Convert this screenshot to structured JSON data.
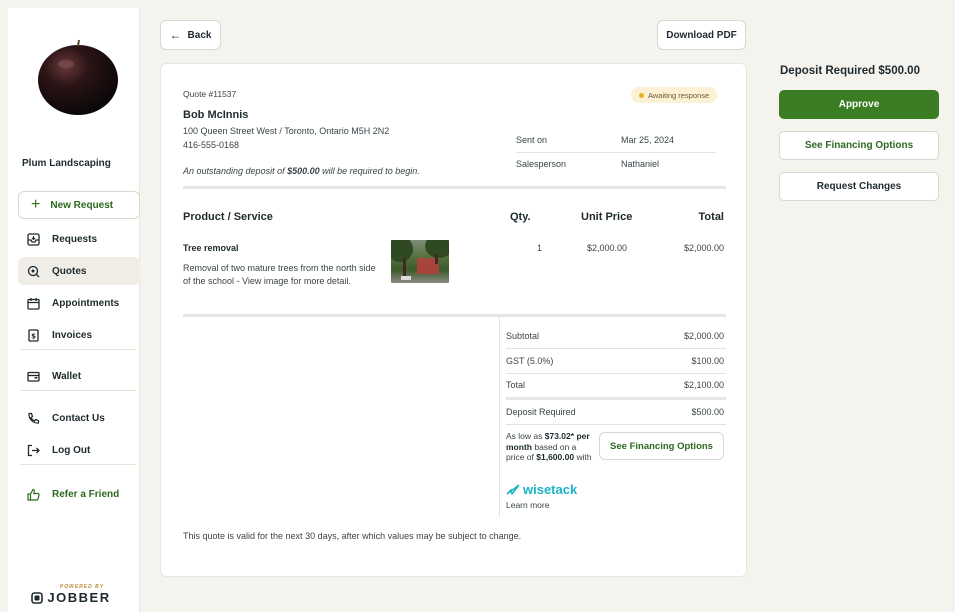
{
  "sidebar": {
    "company": "Plum Landscaping",
    "new_request": "New Request",
    "items": [
      {
        "label": "Requests"
      },
      {
        "label": "Quotes"
      },
      {
        "label": "Appointments"
      },
      {
        "label": "Invoices"
      },
      {
        "label": "Wallet"
      },
      {
        "label": "Contact Us"
      },
      {
        "label": "Log Out"
      },
      {
        "label": "Refer a Friend"
      }
    ],
    "powered_by": "POWERED BY",
    "brand": "JOBBER"
  },
  "toolbar": {
    "back": "Back",
    "download": "Download PDF"
  },
  "quote": {
    "number": "Quote #11537",
    "status": "Awaiting response",
    "client_name": "Bob McInnis",
    "address": "100 Queen Street West / Toronto, Ontario M5H 2N2",
    "phone": "416-555-0168",
    "deposit_note_prefix": "An outstanding deposit of",
    "deposit_note_amount": "$500.00",
    "deposit_note_suffix": "will be required to begin.",
    "sent_on_label": "Sent on",
    "sent_on_value": "Mar 25, 2024",
    "salesperson_label": "Salesperson",
    "salesperson_value": "Nathaniel",
    "headers": {
      "product": "Product / Service",
      "qty": "Qty.",
      "unit_price": "Unit Price",
      "total": "Total"
    },
    "line_item": {
      "name": "Tree removal",
      "description": "Removal of two mature trees from the north side of the school - View image for more detail.",
      "qty": "1",
      "unit_price": "$2,000.00",
      "total": "$2,000.00"
    },
    "summary": {
      "subtotal_label": "Subtotal",
      "subtotal": "$2,000.00",
      "gst_label": "GST (5.0%)",
      "gst": "$100.00",
      "total_label": "Total",
      "total": "$2,100.00",
      "deposit_label": "Deposit Required",
      "deposit": "$500.00"
    },
    "financing": {
      "as_low_as": "As low as",
      "amount": "$73.02*",
      "per_month": "per month",
      "based_on": "based on a price of",
      "price": "$1,600.00",
      "with": "with",
      "provider": "wisetack",
      "learn_more": "Learn more",
      "button": "See Financing Options"
    },
    "validity": "This quote is valid for the next 30 days, after which values may be subject to change."
  },
  "panel": {
    "deposit_title": "Deposit Required $500.00",
    "approve": "Approve",
    "financing": "See Financing Options",
    "changes": "Request Changes"
  },
  "colors": {
    "primary_green": "#3a7d23",
    "status_bg": "#fbf1d5",
    "wisetack": "#1bb3c7"
  }
}
